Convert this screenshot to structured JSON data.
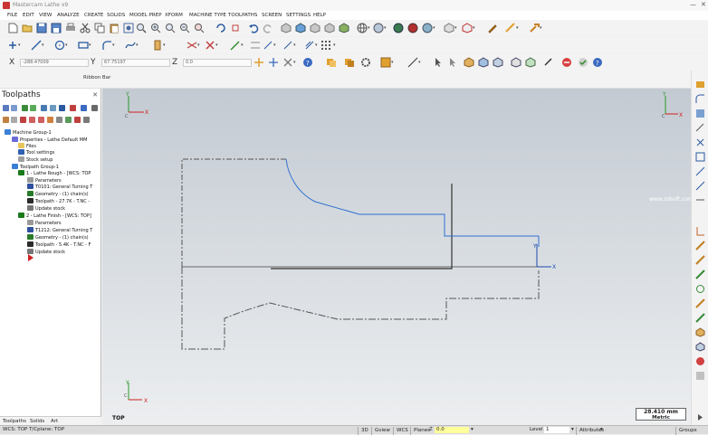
{
  "window": {
    "title": "Mastercam Lathe x9"
  },
  "menu": [
    "FILE",
    "EDIT",
    "VIEW",
    "ANALYZE",
    "CREATE",
    "SOLIDS",
    "MODEL PREP",
    "XFORM",
    "MACHINE TYPE",
    "TOOLPATHS",
    "SCREEN",
    "SETTINGS",
    "HELP"
  ],
  "coords": {
    "x_label": "X",
    "x_value": "-288.47009",
    "y_label": "Y",
    "y_value": "67.75197",
    "z_label": "Z",
    "z_value": "0.0"
  },
  "ribbon": {
    "label": "Ribbon Bar"
  },
  "panel": {
    "title": "Toolpaths",
    "tree": [
      {
        "label": "Machine Group-1",
        "indent": 0,
        "icon": "machine-group-icon",
        "color": "#3a7fd5"
      },
      {
        "label": "Properties - Lathe Default MM",
        "indent": 1,
        "icon": "properties-icon",
        "color": "#6b6bd8"
      },
      {
        "label": "Files",
        "indent": 2,
        "icon": "folder-icon",
        "color": "#e8c45a"
      },
      {
        "label": "Tool settings",
        "indent": 2,
        "icon": "tool-settings-icon",
        "color": "#3060b0"
      },
      {
        "label": "Stock setup",
        "indent": 2,
        "icon": "stock-setup-icon",
        "color": "#a0a0a0"
      },
      {
        "label": "Toolpath Group-1",
        "indent": 1,
        "icon": "toolpath-group-icon",
        "color": "#3a7fd5"
      },
      {
        "label": "1 - Lathe Rough - [WCS: TOP",
        "indent": 2,
        "icon": "operation-icon",
        "color": "#1a7a1a"
      },
      {
        "label": "Parameters",
        "indent": 3,
        "icon": "parameters-icon",
        "color": "#999999"
      },
      {
        "label": "T0101: General Turning T",
        "indent": 3,
        "icon": "tool-icon",
        "color": "#3050a0"
      },
      {
        "label": "Geometry - (1) chain(s)",
        "indent": 3,
        "icon": "geometry-icon",
        "color": "#2a7a2a"
      },
      {
        "label": "Toolpath - 27.7K - T.NC -",
        "indent": 3,
        "icon": "toolpath-icon",
        "color": "#2a2a2a"
      },
      {
        "label": "Update stock",
        "indent": 3,
        "icon": "update-stock-icon",
        "color": "#777777"
      },
      {
        "label": "2 - Lathe Finish - [WCS: TOP]",
        "indent": 2,
        "icon": "operation-icon",
        "color": "#1a7a1a"
      },
      {
        "label": "Parameters",
        "indent": 3,
        "icon": "parameters-icon",
        "color": "#999999"
      },
      {
        "label": "T1212: General Turning T",
        "indent": 3,
        "icon": "tool-icon",
        "color": "#3050a0"
      },
      {
        "label": "Geometry - (1) chain(s)",
        "indent": 3,
        "icon": "geometry-icon",
        "color": "#2a7a2a"
      },
      {
        "label": "Toolpath - 5.4K - T.NC - F",
        "indent": 3,
        "icon": "toolpath-icon",
        "color": "#2a2a2a"
      },
      {
        "label": "Update stock",
        "indent": 3,
        "icon": "update-stock-icon",
        "color": "#777777"
      }
    ],
    "insert_marker": "insert-arrow-icon",
    "tabs": [
      "Toolpaths",
      "Solids",
      "Art"
    ]
  },
  "viewport": {
    "view_label": "TOP",
    "watermark": "www.zdsoft.com",
    "scale_value": "28.410 mm",
    "scale_units": "Metric",
    "axes": [
      "X",
      "Y",
      "C",
      "X",
      "Y",
      "C",
      "X",
      "Y",
      "C",
      "X",
      "Y"
    ]
  },
  "status": {
    "wcs": "WCS: TOP   T/Cplane: TOP",
    "buttons": [
      "3D",
      "Gview",
      "WCS",
      "Planes"
    ],
    "z_label": "Z",
    "z_value": "0.0",
    "level_label": "Level",
    "level_value": "1",
    "attributes": "Attributes",
    "groups": "Groups"
  }
}
